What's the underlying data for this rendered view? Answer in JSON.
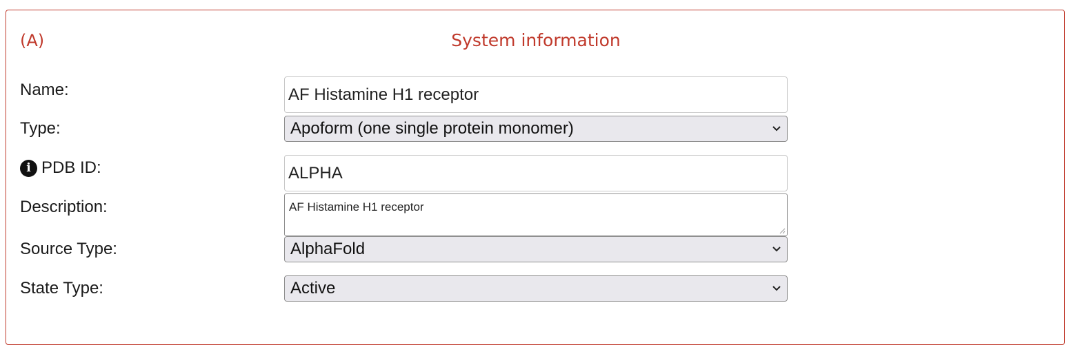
{
  "panel": {
    "label": "(A)",
    "title": "System information"
  },
  "fields": {
    "name": {
      "label": "Name:",
      "value": "AF Histamine H1 receptor"
    },
    "type": {
      "label": "Type:",
      "value": "Apoform (one single protein monomer)"
    },
    "pdb_id": {
      "label": "PDB ID:",
      "value": "ALPHA",
      "icon": "info-icon"
    },
    "description": {
      "label": "Description:",
      "value": "AF Histamine H1 receptor"
    },
    "source_type": {
      "label": "Source Type:",
      "value": "AlphaFold"
    },
    "state_type": {
      "label": "State Type:",
      "value": "Active"
    }
  },
  "colors": {
    "accent": "#c0392b",
    "select_bg": "#e9e8ed"
  }
}
